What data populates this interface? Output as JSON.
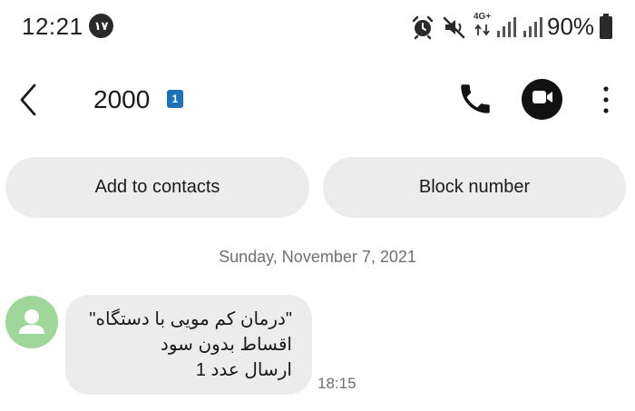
{
  "status_bar": {
    "time": "12:21",
    "notification_count": "۱۷",
    "network_type": "4G+",
    "battery": "90%",
    "icons": [
      "alarm-icon",
      "mute-icon",
      "signal-icon",
      "signal-icon",
      "battery-icon"
    ]
  },
  "header": {
    "contact_number": "2000",
    "sim_label": "1",
    "icons": [
      "back-arrow-icon",
      "phone-icon",
      "video-call-icon",
      "more-vertical-icon"
    ]
  },
  "actions": {
    "add_to_contacts": "Add to contacts",
    "block_number": "Block number"
  },
  "conversation": {
    "date": "Sunday, November 7, 2021",
    "messages": [
      {
        "lines": [
          "\"درمان کم مویی با دستگاه\"",
          "اقساط بدون سود",
          "ارسال عدد 1"
        ],
        "time": "18:15"
      }
    ]
  },
  "colors": {
    "pill_bg": "#ececec",
    "bubble_bg": "#ececec",
    "avatar_bg": "#9fd79a",
    "sim_badge": "#1e73b8"
  }
}
